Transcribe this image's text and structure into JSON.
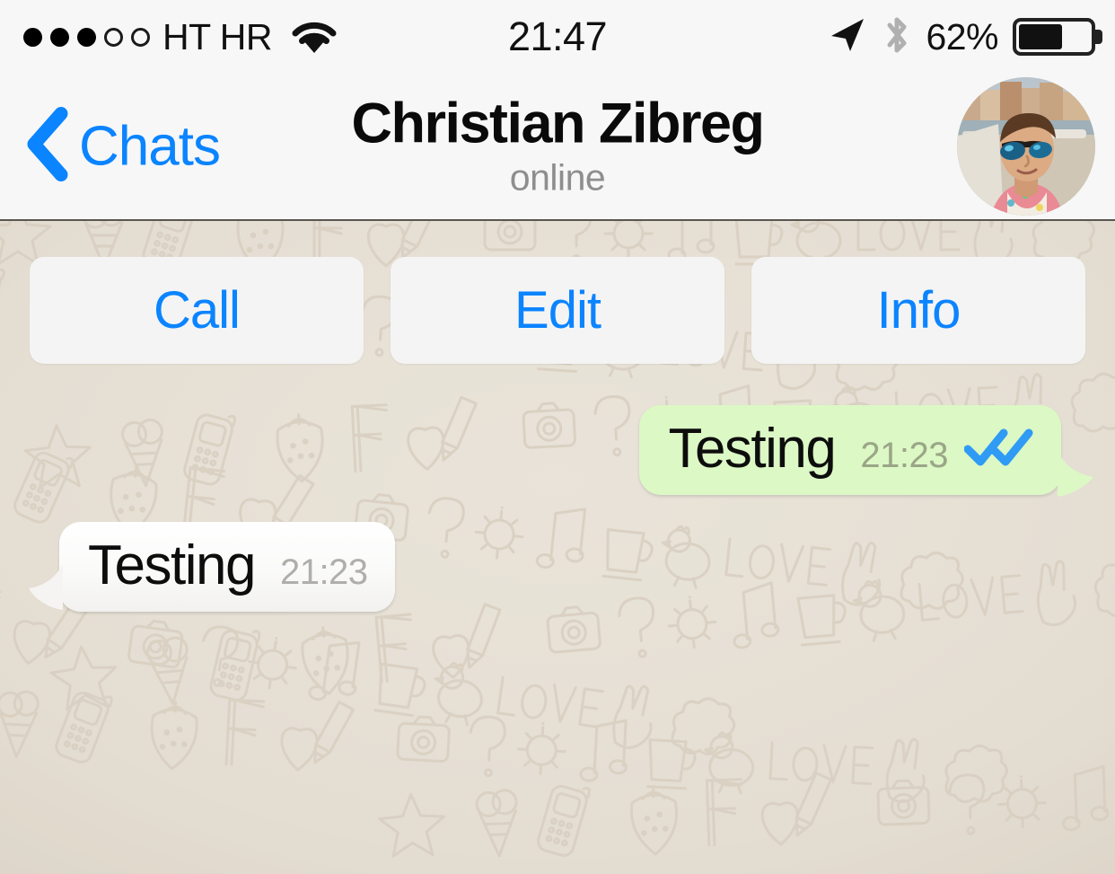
{
  "status_bar": {
    "signal_dots_filled": 3,
    "signal_dots_total": 5,
    "carrier": "HT HR",
    "wifi_icon": "wifi-icon",
    "time": "21:47",
    "location_icon": "location-arrow-icon",
    "bluetooth_icon": "bluetooth-icon",
    "battery_percent_label": "62%",
    "battery_level": 62
  },
  "nav_bar": {
    "back_label": "Chats",
    "back_icon": "chevron-left-icon",
    "title": "Christian Zibreg",
    "subtitle": "online",
    "avatar_alt": "contact-avatar"
  },
  "actions": [
    {
      "label": "Call",
      "name": "call-button"
    },
    {
      "label": "Edit",
      "name": "edit-button"
    },
    {
      "label": "Info",
      "name": "info-button"
    }
  ],
  "messages": [
    {
      "id": "outgoing-1",
      "direction": "outgoing",
      "text": "Testing",
      "time": "21:23",
      "status_icon": "double-check-icon",
      "status": "read"
    },
    {
      "id": "incoming-1",
      "direction": "incoming",
      "text": "Testing",
      "time": "21:23",
      "status_icon": null,
      "status": null
    }
  ],
  "colors": {
    "ios_blue": "#0b84ff",
    "outgoing_bubble": "#dcf8c5",
    "incoming_bubble": "#fcfcfc",
    "wallpaper": "#e7e0d7",
    "nav_background": "#f7f7f7",
    "tick_blue": "#2f9bf5",
    "outgoing_time": "#9aa687",
    "incoming_time": "#b0aeab",
    "subtitle_grey": "#8e8e8e"
  },
  "wallpaper": {
    "name": "whatsapp-doodle-wallpaper",
    "base_color": "#e7e0d7",
    "doodle_color": "#d8d0c4"
  }
}
